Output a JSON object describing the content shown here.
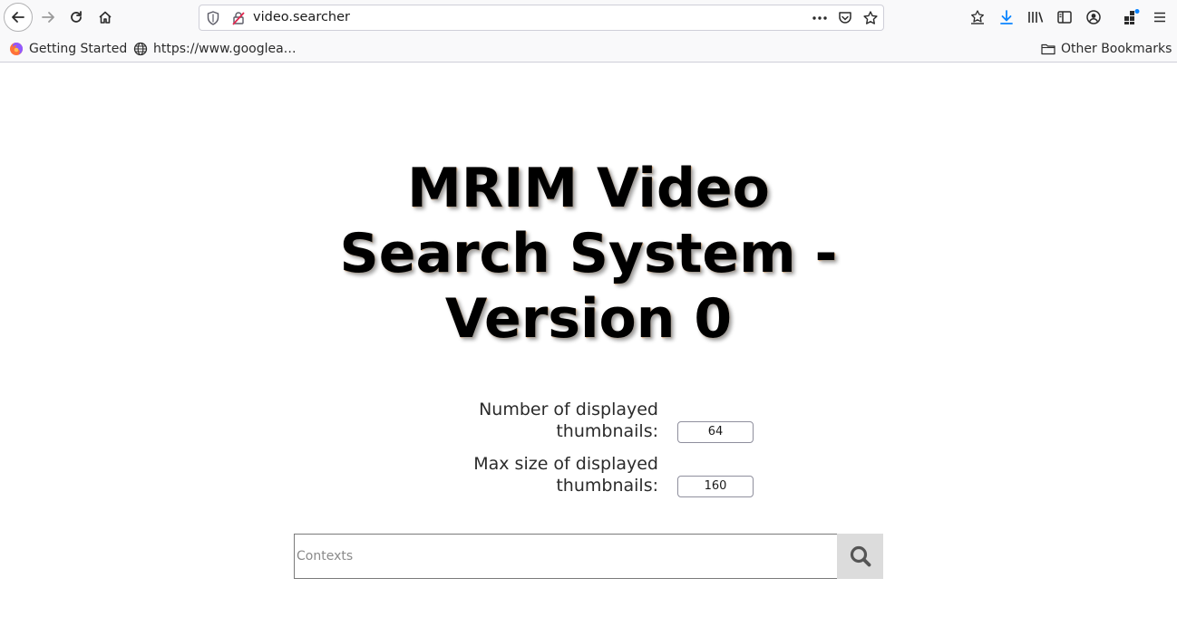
{
  "browser": {
    "url": "video.searcher",
    "bookmarks": [
      {
        "label": "Getting Started",
        "icon": "firefox-icon"
      },
      {
        "label": "https://www.googlea…",
        "icon": "globe-icon"
      }
    ],
    "other_bookmarks": "Other Bookmarks"
  },
  "page": {
    "title_line1": "MRIM Video",
    "title_line2": "Search System -",
    "title_line3": "Version 0",
    "options": [
      {
        "label_line1": "Number of displayed",
        "label_line2": "thumbnails:",
        "value": "64"
      },
      {
        "label_line1": "Max size of displayed",
        "label_line2": "thumbnails:",
        "value": "160"
      }
    ],
    "search": {
      "placeholder": "Contexts",
      "button_icon": "search-icon"
    }
  },
  "colors": {
    "accent_download": "#0a84ff",
    "title_shadow": "#a0a0a0",
    "search_button_bg": "#dcdcdc"
  }
}
